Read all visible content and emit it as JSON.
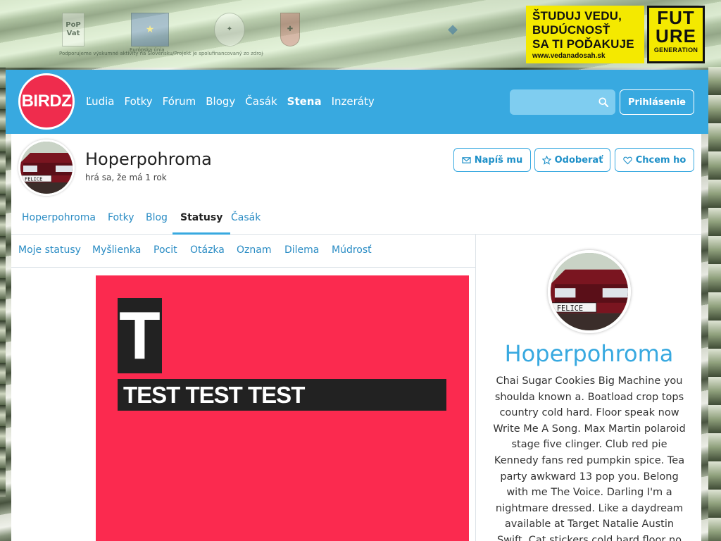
{
  "sponsors": {
    "popvat": "PoP Vat",
    "eu_caption": "Európska únia",
    "small_text": "Podporujeme výskumné aktivity na Slovensku/Projekt je spolufinancovaný zo zdrojov EÚ"
  },
  "ads": {
    "line1": "ŠTUDUJ VEDU,",
    "line2": "BUDÚCNOSŤ",
    "line3": "SA TI POĎAKUJE",
    "url": "www.vedanadosah.sk",
    "future1": "FUT",
    "future2": "URE",
    "future3": "GENERATION"
  },
  "header": {
    "logo": "BIRDZ",
    "nav": [
      "Ľudia",
      "Fotky",
      "Fórum",
      "Blogy",
      "Časák",
      "Stena",
      "Inzeráty"
    ],
    "search_placeholder": "",
    "login": "Prihlásenie"
  },
  "profile": {
    "name": "Hoperpohroma",
    "subtitle": "hrá sa, že má 1 rok",
    "plate": "FELICE",
    "buttons": {
      "write": "Napíš mu",
      "follow": "Odoberať",
      "want": "Chcem ho"
    }
  },
  "tabs": [
    "Hoperpohroma",
    "Fotky",
    "Blog",
    "Statusy",
    "Časák"
  ],
  "subtabs": [
    "Moje statusy",
    "Myšlienka",
    "Pocit",
    "Otázka",
    "Oznam",
    "Dilema",
    "Múdrosť"
  ],
  "status": {
    "letter": "T",
    "text": "TEST TEST TEST"
  },
  "sidebar": {
    "name": "Hoperpohroma",
    "bio": "Chai Sugar Cookies Big Machine you shoulda known a. Boatload crop tops country cold hard. Floor speak now Write Me A Song. Max Martin polaroid stage five clinger. Club red pie Kennedy fans red pumpkin spice. Tea party awkward 13 pop you. Belong with me The Voice. Darling I'm a nightmare dressed. Like a daydream available at Target Natalie Austin Swift. Cat stickers cold hard floor no it's Becky ex Country"
  }
}
